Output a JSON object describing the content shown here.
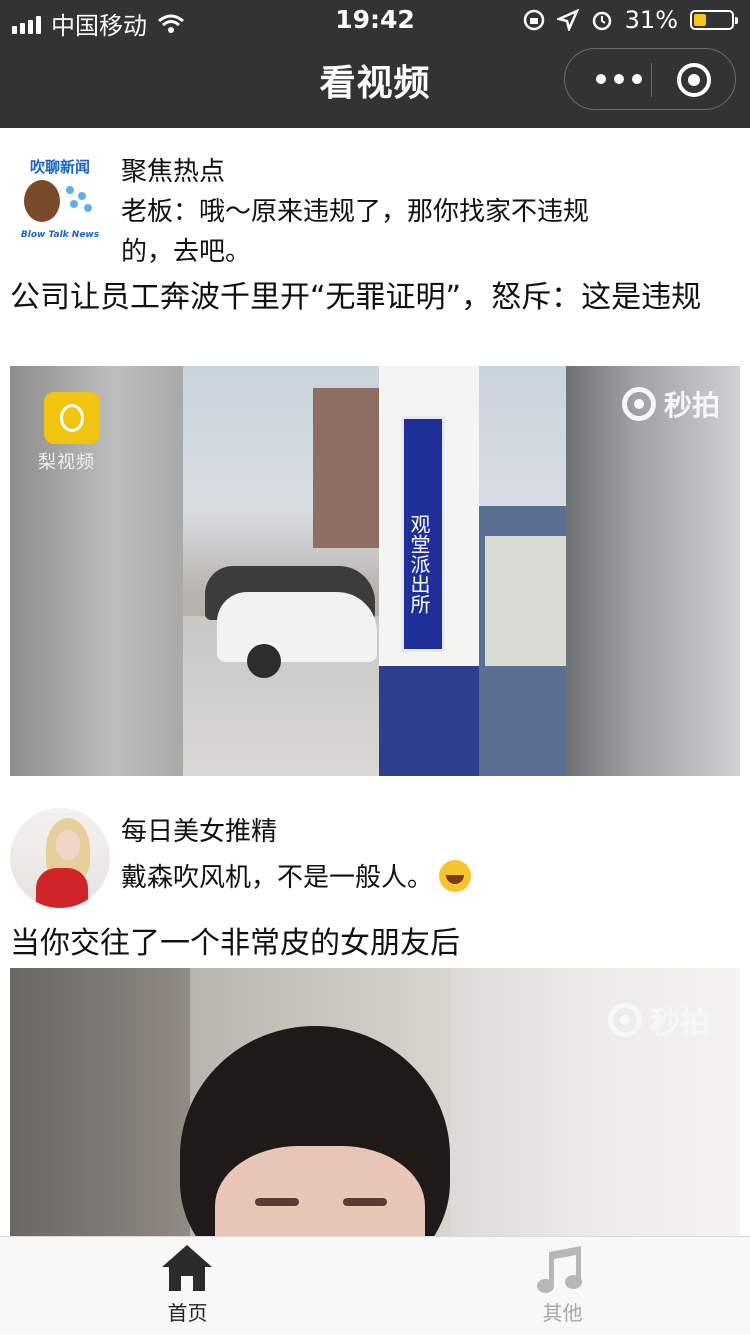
{
  "status_bar": {
    "carrier": "中国移动",
    "time": "19:42",
    "battery": "31%"
  },
  "nav": {
    "title": "看视频"
  },
  "posts": [
    {
      "author": "聚焦热点",
      "caption": "老板：哦～原来违规了，那你找家不违规的，去吧。",
      "headline": "公司让员工奔波千里开“无罪证明”，怒斥：这是违规",
      "avatar_logo_text": "吹聊新闻",
      "avatar_logo_sub": "Blow Talk News",
      "watermark_left": "梨视频",
      "watermark_right": "秒拍",
      "sign_text": "观堂派出所"
    },
    {
      "author": "每日美女推精",
      "caption": "戴森吹风机，不是一般人。",
      "caption_emoji": "face-with-tears-of-joy",
      "headline": "当你交往了一个非常皮的女朋友后",
      "watermark_right": "秒拍"
    }
  ],
  "tabbar": {
    "home_label": "首页",
    "other_label": "其他",
    "active_color": "#222222",
    "inactive_color": "#a8a8a8"
  },
  "colors": {
    "nav_bg": "#333333",
    "battery_fill": "#f5c518"
  }
}
